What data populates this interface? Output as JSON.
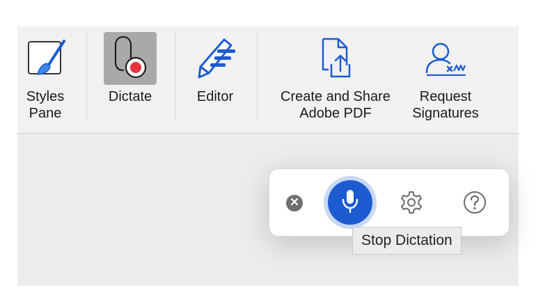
{
  "ribbon": {
    "items": [
      {
        "label_line1": "Styles",
        "label_line2": "Pane",
        "icon": "styles-pane-icon"
      },
      {
        "label": "Dictate",
        "icon": "dictate-icon",
        "active": true
      },
      {
        "label": "Editor",
        "icon": "editor-pen-icon"
      },
      {
        "label_line1": "Create and Share",
        "label_line2": "Adobe PDF",
        "icon": "adobe-pdf-share-icon"
      },
      {
        "label_line1": "Request",
        "label_line2": "Signatures",
        "icon": "request-signatures-icon"
      }
    ]
  },
  "dictation_toolbar": {
    "close_icon": "close-icon",
    "mic_icon": "microphone-icon",
    "settings_icon": "gear-icon",
    "help_icon": "help-icon",
    "tooltip": "Stop Dictation"
  },
  "colors": {
    "accent_blue": "#1c5bd0",
    "record_red": "#e8323c",
    "ribbon_bg": "#f1f1f1"
  }
}
